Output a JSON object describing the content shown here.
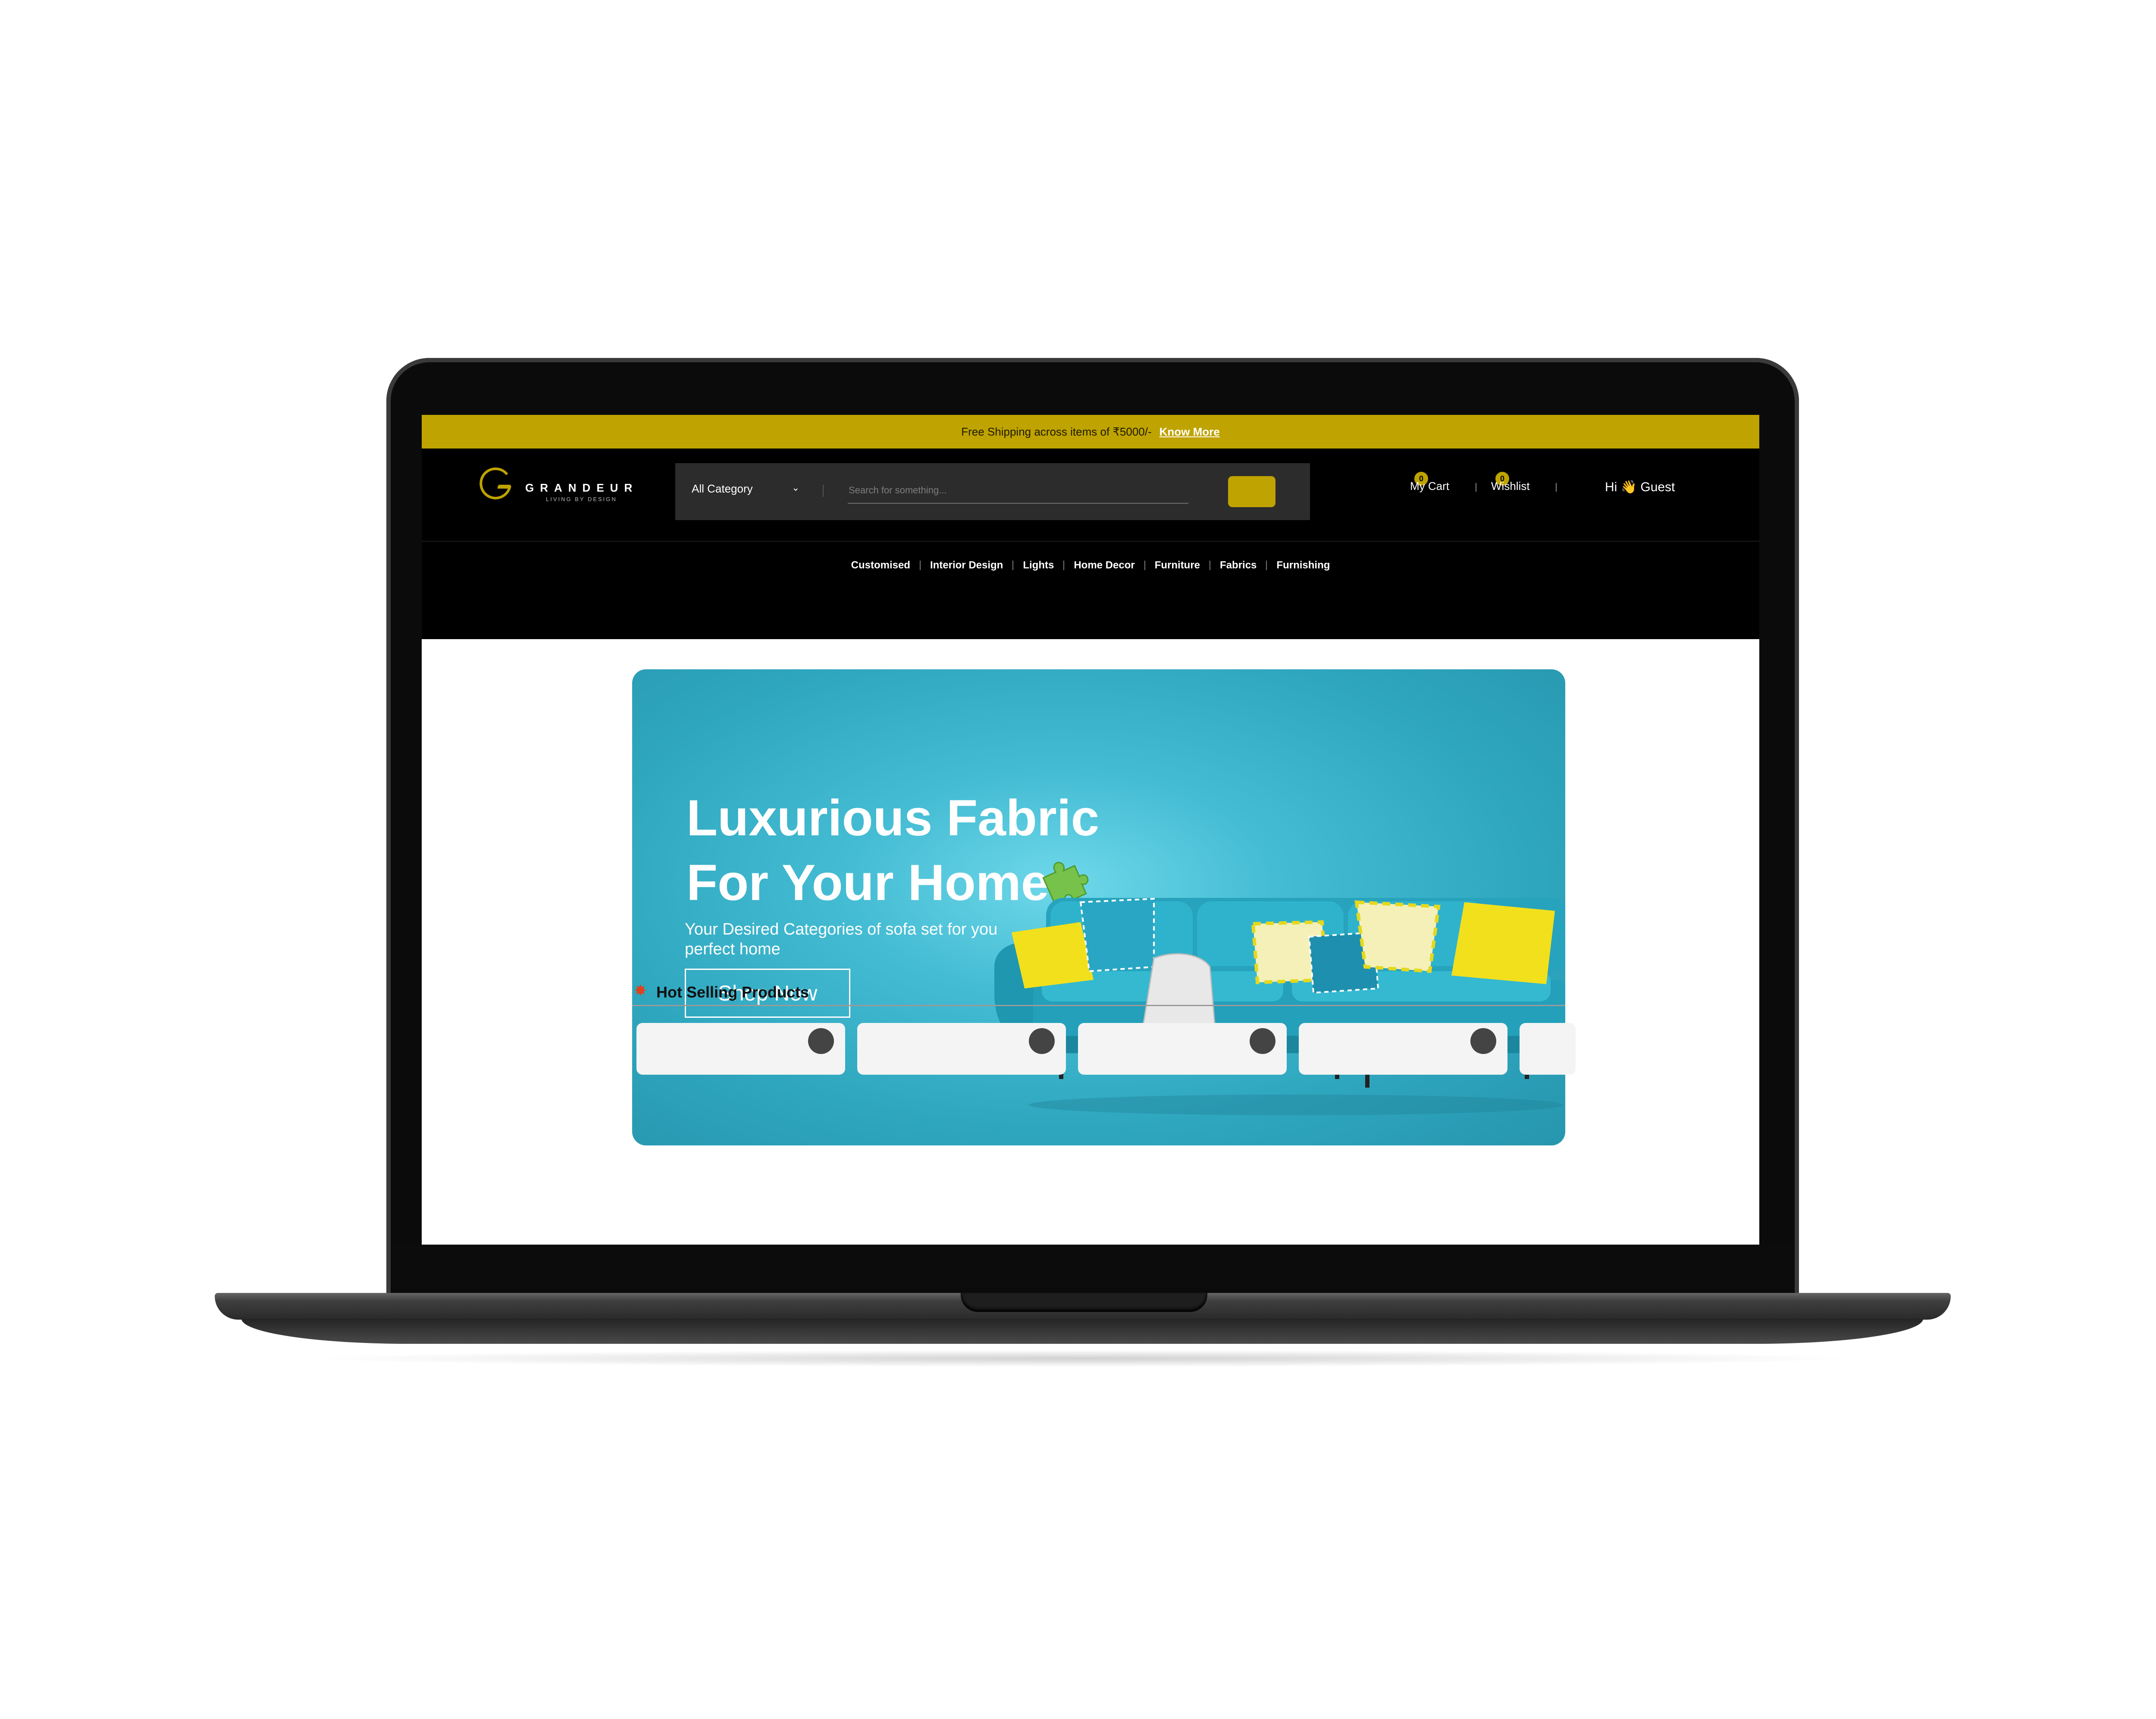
{
  "promo": {
    "text": "Free Shipping across items of ₹5000/-",
    "link_label": "Know More"
  },
  "brand": {
    "name": "GRANDEUR",
    "tagline": "LIVING BY DESIGN",
    "accent_color": "#bfa300"
  },
  "search": {
    "category": "All Category",
    "placeholder": "Search for something..."
  },
  "header": {
    "cart_label": "My Cart",
    "cart_count": "0",
    "wishlist_label": "Wishlist",
    "wishlist_count": "0",
    "greeting": "Hi 👋 Guest"
  },
  "nav": {
    "items": [
      "Customised",
      "Interior Design",
      "Lights",
      "Home Decor",
      "Furniture",
      "Fabrics",
      "Furnishing"
    ]
  },
  "hero": {
    "title_line1": "Luxurious Fabric",
    "title_line2": "For Your Home",
    "subtitle": "Your Desired Categories of sofa set for you perfect home",
    "cta": "Shop Now",
    "background_color": "#2fa7bf"
  },
  "section": {
    "hot_title": "Hot Selling Products"
  }
}
